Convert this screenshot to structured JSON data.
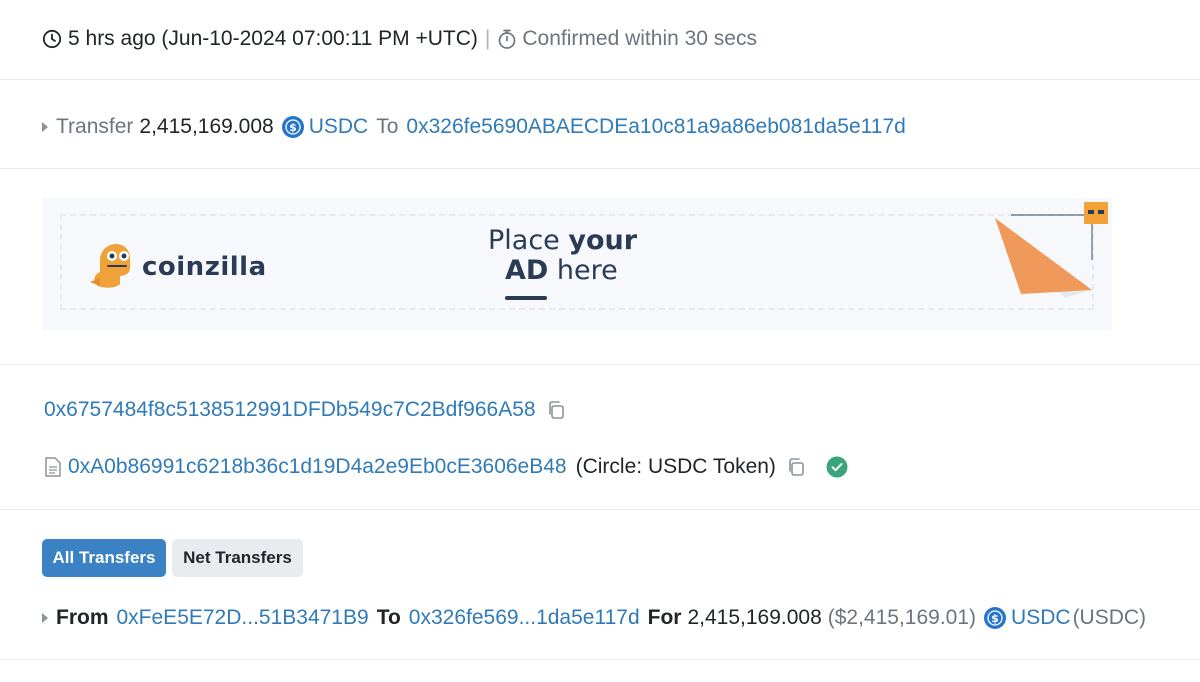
{
  "timestamp": {
    "age": "5 hrs ago (Jun-10-2024 07:00:11 PM +UTC)",
    "separator": "|",
    "confirmed": "Confirmed within 30 secs"
  },
  "action": {
    "label": "Transfer",
    "amount": "2,415,169.008",
    "token": "USDC",
    "to_label": "To",
    "to_address": "0x326fe5690ABAECDEa10c81a9a86eb081da5e117d"
  },
  "ad": {
    "brand": "coinzilla",
    "line1_a": "Place",
    "line1_b": "your",
    "line2_a": "AD",
    "line2_b": "here"
  },
  "addresses": {
    "from": "0x6757484f8c5138512991DFDb549c7C2Bdf966A58",
    "contract": "0xA0b86991c6218b36c1d19D4a2e9Eb0cE3606eB48",
    "contract_name": "(Circle: USDC Token)"
  },
  "tabs": {
    "all": "All Transfers",
    "net": "Net Transfers"
  },
  "transfer": {
    "from_label": "From",
    "from": "0xFeE5E72D...51B3471B9",
    "to_label": "To",
    "to": "0x326fe569...1da5e117d",
    "for_label": "For",
    "amount": "2,415,169.008",
    "usd": "($2,415,169.01)",
    "token": "USDC",
    "token_symbol": "(USDC)"
  },
  "colors": {
    "link": "#2f7ab8",
    "usdc": "#2775ca",
    "verified": "#3aa57a",
    "primary": "#3a82c4"
  }
}
